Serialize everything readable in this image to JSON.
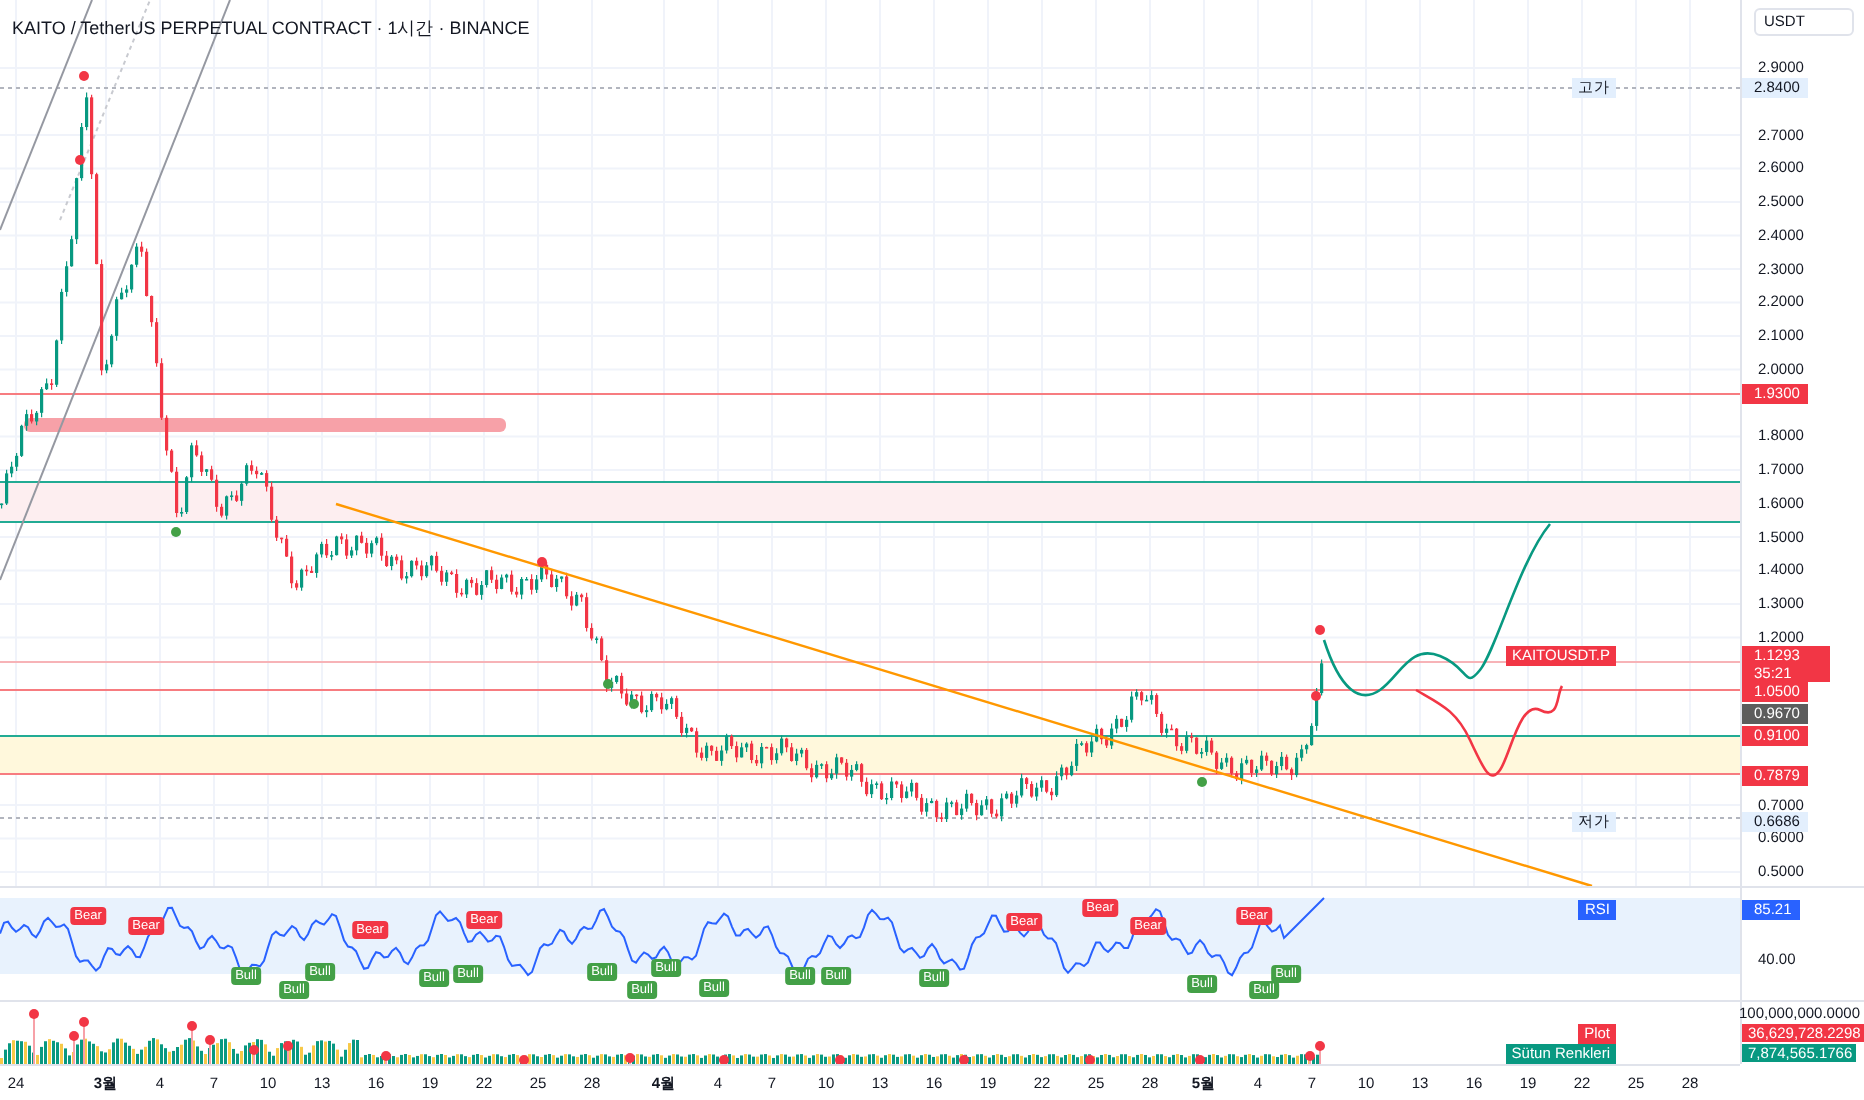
{
  "title": "KAITO / TetherUS PERPETUAL CONTRACT · 1시간 · BINANCE",
  "currency": "USDT",
  "price_ticks": [
    "2.9000",
    "2.7000",
    "2.6000",
    "2.5000",
    "2.4000",
    "2.3000",
    "2.2000",
    "2.1000",
    "2.0000",
    "1.8000",
    "1.7000",
    "1.6000",
    "1.5000",
    "1.4000",
    "1.3000",
    "1.2000",
    "0.7000",
    "0.6000",
    "0.5000"
  ],
  "price_labels": [
    {
      "kind": "high",
      "tag": "고가",
      "value": "2.8400"
    },
    {
      "kind": "level",
      "value": "1.9300"
    },
    {
      "kind": "last",
      "tag": "KAITOUSDT.P",
      "value": "1.1293",
      "countdown": "35:21"
    },
    {
      "kind": "level",
      "value": "1.0500"
    },
    {
      "kind": "mark",
      "value": "0.9670"
    },
    {
      "kind": "level",
      "value": "0.9100"
    },
    {
      "kind": "level",
      "value": "0.7879"
    },
    {
      "kind": "low",
      "tag": "저가",
      "value": "0.6686"
    }
  ],
  "rsi": {
    "tag": "RSI",
    "value": "85.21",
    "ticks": [
      "40.00"
    ],
    "signals": [
      {
        "kind": "bear",
        "label": "Bear"
      },
      {
        "kind": "bear",
        "label": "Bear"
      },
      {
        "kind": "bear",
        "label": "Bear"
      },
      {
        "kind": "bear",
        "label": "Bear"
      },
      {
        "kind": "bear",
        "label": "Bear"
      },
      {
        "kind": "bear",
        "label": "Bear"
      },
      {
        "kind": "bear",
        "label": "Bear"
      },
      {
        "kind": "bear",
        "label": "Bear"
      },
      {
        "kind": "bull",
        "label": "Bull"
      },
      {
        "kind": "bull",
        "label": "Bull"
      },
      {
        "kind": "bull",
        "label": "Bull"
      },
      {
        "kind": "bull",
        "label": "Bull"
      },
      {
        "kind": "bull",
        "label": "Bull"
      },
      {
        "kind": "bull",
        "label": "Bull"
      },
      {
        "kind": "bull",
        "label": "Bull"
      },
      {
        "kind": "bull",
        "label": "Bull"
      },
      {
        "kind": "bull",
        "label": "Bull"
      },
      {
        "kind": "bull",
        "label": "Bull"
      },
      {
        "kind": "bull",
        "label": "Bull"
      },
      {
        "kind": "bull",
        "label": "Bull"
      },
      {
        "kind": "bull",
        "label": "Bull"
      },
      {
        "kind": "bull",
        "label": "Bull"
      },
      {
        "kind": "bull",
        "label": "Bull"
      }
    ]
  },
  "volume": {
    "ticks": [
      "100,000,000.0000"
    ],
    "labels": [
      {
        "tag": "Plot",
        "value": "36,629,728.2298",
        "color": "#f23645"
      },
      {
        "tag": "Sütun Renkleri",
        "value": "7,874,565.1766",
        "color": "#089981"
      }
    ]
  },
  "time_axis": [
    "24",
    "3월",
    "4",
    "7",
    "10",
    "13",
    "16",
    "19",
    "22",
    "25",
    "28",
    "4월",
    "4",
    "7",
    "10",
    "13",
    "16",
    "19",
    "22",
    "25",
    "28",
    "5월",
    "4",
    "7",
    "10",
    "13",
    "16",
    "19",
    "22",
    "25",
    "28"
  ]
}
